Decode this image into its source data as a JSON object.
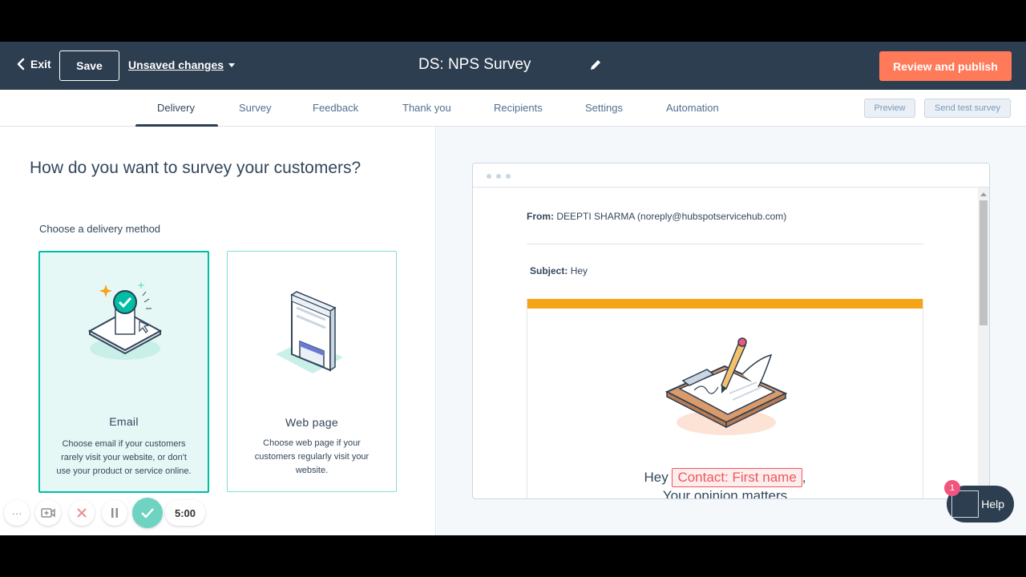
{
  "header": {
    "exit_label": "Exit",
    "save_label": "Save",
    "unsaved_label": "Unsaved changes",
    "title": "DS: NPS Survey",
    "publish_label": "Review and publish"
  },
  "tabs": [
    {
      "label": "Delivery",
      "active": true
    },
    {
      "label": "Survey",
      "active": false
    },
    {
      "label": "Feedback",
      "active": false
    },
    {
      "label": "Thank you",
      "active": false
    },
    {
      "label": "Recipients",
      "active": false
    },
    {
      "label": "Settings",
      "active": false
    },
    {
      "label": "Automation",
      "active": false
    }
  ],
  "toolbar": {
    "preview_label": "Preview",
    "send_test_label": "Send test survey"
  },
  "left": {
    "question": "How do you want to survey your customers?",
    "choose_label": "Choose a delivery method",
    "cards": [
      {
        "name": "Email",
        "description": "Choose email if your customers rarely visit your website, or don't use your product or service online.",
        "selected": true
      },
      {
        "name": "Web page",
        "description": "Choose web page if your customers regularly visit your website.",
        "selected": false
      }
    ]
  },
  "preview": {
    "from_label": "From:",
    "from_value": "DEEPTI SHARMA (noreply@hubspotservicehub.com)",
    "subject_label": "Subject:",
    "subject_value": "Hey",
    "greeting": "Hey",
    "token": "Contact: First name",
    "comma": ",",
    "subline": "Your opinion matters"
  },
  "recorder": {
    "more": "···",
    "timer": "5:00"
  },
  "help": {
    "label": "Help",
    "badge": "1"
  },
  "colors": {
    "header_bg": "#2d3e50",
    "publish": "#ff7a59",
    "teal": "#00bda5",
    "orange_bar": "#f5a416",
    "token": "#f2545b"
  }
}
